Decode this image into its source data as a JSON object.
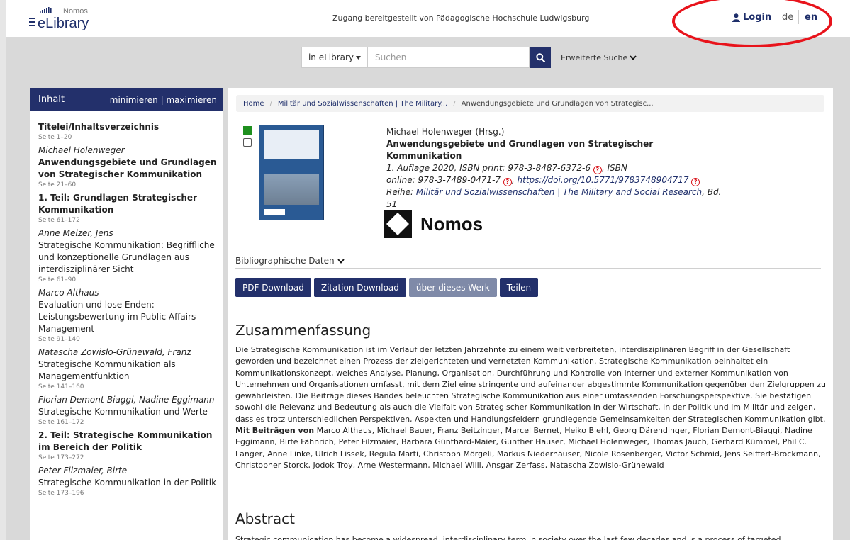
{
  "header": {
    "logo_small": "Nomos",
    "logo_main": "eLibrary",
    "access_note": "Zugang bereitgestellt von Pädagogische Hochschule Ludwigsburg",
    "login": "Login",
    "lang_de": "de",
    "lang_en": "en"
  },
  "search": {
    "scope": "in eLibrary",
    "placeholder": "Suchen",
    "advanced": "Erweiterte Suche"
  },
  "sidebar": {
    "title": "Inhalt",
    "controls": "minimieren | maximieren",
    "entries": [
      {
        "author": "",
        "title": "Titelei/Inhaltsverzeichnis",
        "bold": true,
        "pages": "Seite 1–20"
      },
      {
        "author": "Michael Holenweger",
        "title": "Anwendungsgebiete und Grundlagen von Strategischer Kommunikation",
        "bold": true,
        "pages": "Seite 21–60"
      },
      {
        "author": "",
        "title": "1. Teil: Grundlagen Strategischer Kommunikation",
        "bold": true,
        "pages": "Seite 61–172"
      },
      {
        "author": "Anne Melzer, Jens",
        "title": "Strategische Kommunikation: Begriffliche und konzeptionelle Grundlagen aus interdisziplinärer Sicht",
        "bold": false,
        "pages": "Seite 61–90"
      },
      {
        "author": "Marco Althaus",
        "title": "Evaluation und lose Enden: Leistungsbewertung im Public Affairs Management",
        "bold": false,
        "pages": "Seite 91–140"
      },
      {
        "author": "Natascha Zowislo-Grünewald, Franz",
        "title": "Strategische Kommunikation als Managementfunktion",
        "bold": false,
        "pages": "Seite 141–160"
      },
      {
        "author": "Florian Demont-Biaggi, Nadine Eggimann",
        "title": "Strategische Kommunikation und Werte",
        "bold": false,
        "pages": "Seite 161–172"
      },
      {
        "author": "",
        "title": "2. Teil: Strategische Kommunikation im Bereich der Politik",
        "bold": true,
        "pages": "Seite 173–272"
      },
      {
        "author": "Peter Filzmaier, Birte",
        "title": "Strategische Kommunikation in der Politik",
        "bold": false,
        "pages": "Seite 173–196"
      }
    ]
  },
  "breadcrumb": {
    "home": "Home",
    "level1": "Militär und Sozialwissenschaften | The Military...",
    "current": "Anwendungsgebiete und Grundlagen von Strategisc..."
  },
  "book": {
    "editor": "Michael Holenweger (Hrsg.)",
    "title": "Anwendungsgebiete und Grundlagen von Strategischer Kommunikation",
    "edition": "1. Auflage 2020, ISBN print: 978-3-8487-6372-6",
    "isbn_label": "ISBN",
    "online_prefix": "online: 978-3-7489-0471-7",
    "doi": "https://doi.org/10.5771/9783748904717",
    "series_prefix": "Reihe:",
    "series": "Militär und Sozialwissenschaften | The Military and Social Research",
    "volume": ", Bd. 51",
    "publisher": "Nomos"
  },
  "bib_data": "Bibliographische Daten",
  "buttons": {
    "pdf": "PDF Download",
    "citation": "Zitation Download",
    "about": "über dieses Werk",
    "share": "Teilen"
  },
  "summary": {
    "heading": "Zusammenfassung",
    "text": "Die Strategische Kommunikation ist im Verlauf der letzten Jahrzehnte zu einem weit verbreiteten, interdisziplinären Begriff in der Gesellschaft geworden und bezeichnet einen Prozess der zielgerichteten und vernetzten Kommunikation. Strategische Kommunikation beinhaltet ein Kommunikationskonzept, welches Analyse, Planung, Organisation, Durchführung und Kontrolle von interner und externer Kommunikation von Unternehmen und Organisationen umfasst, mit dem Ziel eine stringente und aufeinander abgestimmte Kommunikation gegenüber den Zielgruppen zu gewährleisten. Die Beiträge dieses Bandes beleuchten Strategische Kommunikation aus einer umfassenden Forschungsperspektive. Sie bestätigen sowohl die Relevanz und Bedeutung als auch die Vielfalt von Strategischer Kommunikation in der Wirtschaft, in der Politik und im Militär und zeigen, dass es trotz unterschiedlichen Perspektiven, Aspekten und Handlungsfeldern grundlegende Gemeinsamkeiten der Strategischen Kommunikation gibt.",
    "contrib_label": "Mit Beiträgen von",
    "contributors": "Marco Althaus, Michael Bauer, Franz Beitzinger, Marcel Bernet, Heiko Biehl, Georg Därendinger, Florian Demont-Biaggi, Nadine Eggimann, Birte Fähnrich, Peter Filzmaier, Barbara Günthard-Maier, Gunther Hauser, Michael Holenweger, Thomas Jauch, Gerhard Kümmel, Phil C. Langer, Anne Linke, Ulrich Lissek, Regula Marti, Christoph Mörgeli, Markus Niederhäuser, Nicole Rosenberger, Victor Schmid, Jens Seiffert-Brockmann, Christopher Storck, Jodok Troy, Arne Westermann, Michael Willi, Ansgar Zerfass, Natascha Zowislo-Grünewald"
  },
  "abstract": {
    "heading": "Abstract",
    "text": "Strategic communication has become a widespread, interdisciplinary term in society over the last few decades and is a process of targeted"
  }
}
